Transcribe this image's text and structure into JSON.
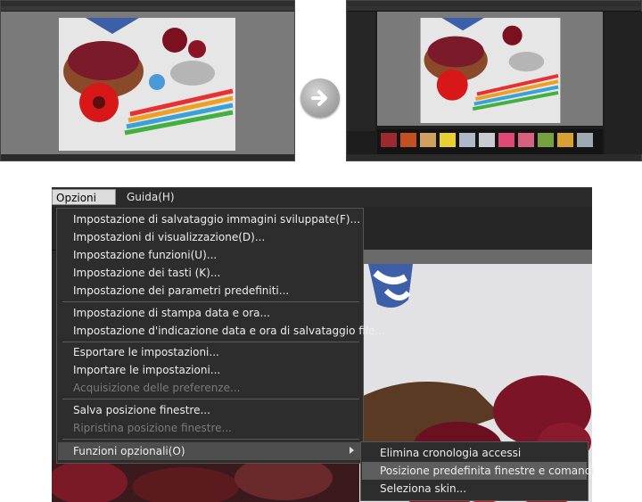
{
  "menubar": {
    "options_label": "Opzioni (O)",
    "help_label": "Guida(H)"
  },
  "menu": {
    "items": [
      "Impostazione di salvataggio immagini sviluppate(F)...",
      "Impostazioni di visualizzazione(D)...",
      "Impostazione funzioni(U)...",
      "Impostazione dei tasti (K)...",
      "Impostazione dei parametri predefiniti...",
      "Impostazione di stampa data e ora...",
      "Impostazione d'indicazione data e ora di salvataggio file...",
      "Esportare le impostazioni...",
      "Importare le impostazioni...",
      "Acquisizione delle preferenze...",
      "Salva posizione finestre...",
      "Ripristina posizione finestre...",
      "Funzioni opzionali(O)"
    ]
  },
  "submenu": {
    "items": [
      "Elimina cronologia accessi",
      "Posizione predefinita finestre e comandi",
      "Seleziona skin..."
    ]
  },
  "icons": {
    "transition": "arrow-right-icon",
    "submenu": "chevron-right-icon"
  },
  "colors": {
    "menu_bg": "#2d2d2d",
    "highlight": "#5e5e5e",
    "disabled_text": "#7a7a7a",
    "window_bg": "#7a7a7a"
  }
}
